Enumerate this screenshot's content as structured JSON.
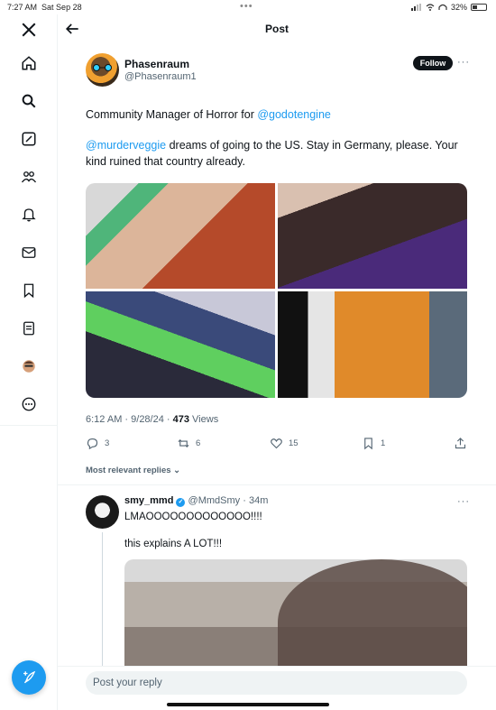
{
  "status_bar": {
    "time": "7:27 AM",
    "date": "Sat Sep 28",
    "battery": "32%"
  },
  "header": {
    "title": "Post"
  },
  "sidebar": {
    "items": [
      {
        "name": "x-logo"
      },
      {
        "name": "home"
      },
      {
        "name": "explore"
      },
      {
        "name": "grok"
      },
      {
        "name": "communities"
      },
      {
        "name": "notifications"
      },
      {
        "name": "messages"
      },
      {
        "name": "bookmarks"
      },
      {
        "name": "lists"
      },
      {
        "name": "profile"
      },
      {
        "name": "more"
      }
    ]
  },
  "post": {
    "display_name": "Phasenraum",
    "handle": "@Phasenraum1",
    "follow_label": "Follow",
    "bio_line_text": "Community Manager of Horror for ",
    "bio_line_mention": "@godotengine",
    "text_mention": "@murderveggie",
    "text_rest": " dreams of going to the US. Stay in Germany, please. Your kind ruined that country already.",
    "time": "6:12 AM",
    "date": "9/28/24",
    "views_count": "473",
    "views_label": "Views",
    "stats": {
      "replies": "3",
      "reposts": "6",
      "likes": "15",
      "bookmarks": "1"
    }
  },
  "replies_filter": "Most relevant replies",
  "reply": {
    "display_name": "smy_mmd",
    "handle": "@MmdSmy",
    "age": "34m",
    "line1": "LMAOOOOOOOOOOOOO!!!!",
    "line2": "this explains A LOT!!!"
  },
  "reply_bar": {
    "placeholder": "Post your reply"
  },
  "colors": {
    "accent": "#1d9bf0",
    "text": "#0f1419",
    "muted": "#536471"
  }
}
